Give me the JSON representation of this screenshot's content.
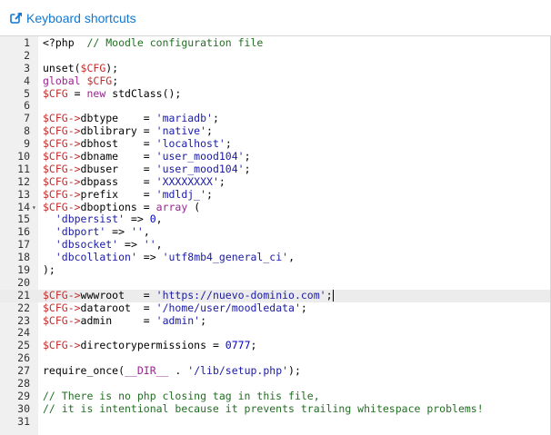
{
  "toolbar": {
    "shortcuts_label": "Keyboard shortcuts",
    "shortcuts_icon": "external-link-icon",
    "link_color": "#1177d1"
  },
  "editor": {
    "active_line": 21,
    "lines": [
      {
        "n": "1",
        "tokens": [
          {
            "t": "<?php",
            "c": "plain"
          },
          {
            "t": "  // Moodle configuration file",
            "c": "cm"
          }
        ]
      },
      {
        "n": "2",
        "tokens": []
      },
      {
        "n": "3",
        "tokens": [
          {
            "t": "unset(",
            "c": "plain"
          },
          {
            "t": "$CFG",
            "c": "var"
          },
          {
            "t": ");",
            "c": "plain"
          }
        ]
      },
      {
        "n": "4",
        "tokens": [
          {
            "t": "global",
            "c": "kw"
          },
          {
            "t": " ",
            "c": "plain"
          },
          {
            "t": "$CFG",
            "c": "var"
          },
          {
            "t": ";",
            "c": "plain"
          }
        ]
      },
      {
        "n": "5",
        "tokens": [
          {
            "t": "$CFG",
            "c": "var"
          },
          {
            "t": " = ",
            "c": "plain"
          },
          {
            "t": "new",
            "c": "kw"
          },
          {
            "t": " stdClass();",
            "c": "plain"
          }
        ]
      },
      {
        "n": "6",
        "tokens": []
      },
      {
        "n": "7",
        "tokens": [
          {
            "t": "$CFG->",
            "c": "var"
          },
          {
            "t": "dbtype    = ",
            "c": "plain"
          },
          {
            "t": "'mariadb'",
            "c": "str"
          },
          {
            "t": ";",
            "c": "plain"
          }
        ]
      },
      {
        "n": "8",
        "tokens": [
          {
            "t": "$CFG->",
            "c": "var"
          },
          {
            "t": "dblibrary = ",
            "c": "plain"
          },
          {
            "t": "'native'",
            "c": "str"
          },
          {
            "t": ";",
            "c": "plain"
          }
        ]
      },
      {
        "n": "9",
        "tokens": [
          {
            "t": "$CFG->",
            "c": "var"
          },
          {
            "t": "dbhost    = ",
            "c": "plain"
          },
          {
            "t": "'localhost'",
            "c": "str"
          },
          {
            "t": ";",
            "c": "plain"
          }
        ]
      },
      {
        "n": "10",
        "tokens": [
          {
            "t": "$CFG->",
            "c": "var"
          },
          {
            "t": "dbname    = ",
            "c": "plain"
          },
          {
            "t": "'user_mood104'",
            "c": "str"
          },
          {
            "t": ";",
            "c": "plain"
          }
        ]
      },
      {
        "n": "11",
        "tokens": [
          {
            "t": "$CFG->",
            "c": "var"
          },
          {
            "t": "dbuser    = ",
            "c": "plain"
          },
          {
            "t": "'user_mood104'",
            "c": "str"
          },
          {
            "t": ";",
            "c": "plain"
          }
        ]
      },
      {
        "n": "12",
        "tokens": [
          {
            "t": "$CFG->",
            "c": "var"
          },
          {
            "t": "dbpass    = ",
            "c": "plain"
          },
          {
            "t": "'XXXXXXXX'",
            "c": "str"
          },
          {
            "t": ";",
            "c": "plain"
          }
        ]
      },
      {
        "n": "13",
        "tokens": [
          {
            "t": "$CFG->",
            "c": "var"
          },
          {
            "t": "prefix    = ",
            "c": "plain"
          },
          {
            "t": "'mdldj_'",
            "c": "str"
          },
          {
            "t": ";",
            "c": "plain"
          }
        ]
      },
      {
        "n": "14",
        "fold": true,
        "tokens": [
          {
            "t": "$CFG->",
            "c": "var"
          },
          {
            "t": "dboptions = ",
            "c": "plain"
          },
          {
            "t": "array",
            "c": "kw"
          },
          {
            "t": " (",
            "c": "plain"
          }
        ]
      },
      {
        "n": "15",
        "tokens": [
          {
            "t": "  ",
            "c": "plain"
          },
          {
            "t": "'dbpersist'",
            "c": "str"
          },
          {
            "t": " => ",
            "c": "plain"
          },
          {
            "t": "0",
            "c": "num-lit"
          },
          {
            "t": ",",
            "c": "plain"
          }
        ]
      },
      {
        "n": "16",
        "tokens": [
          {
            "t": "  ",
            "c": "plain"
          },
          {
            "t": "'dbport'",
            "c": "str"
          },
          {
            "t": " => ",
            "c": "plain"
          },
          {
            "t": "''",
            "c": "str"
          },
          {
            "t": ",",
            "c": "plain"
          }
        ]
      },
      {
        "n": "17",
        "tokens": [
          {
            "t": "  ",
            "c": "plain"
          },
          {
            "t": "'dbsocket'",
            "c": "str"
          },
          {
            "t": " => ",
            "c": "plain"
          },
          {
            "t": "''",
            "c": "str"
          },
          {
            "t": ",",
            "c": "plain"
          }
        ]
      },
      {
        "n": "18",
        "tokens": [
          {
            "t": "  ",
            "c": "plain"
          },
          {
            "t": "'dbcollation'",
            "c": "str"
          },
          {
            "t": " => ",
            "c": "plain"
          },
          {
            "t": "'utf8mb4_general_ci'",
            "c": "str"
          },
          {
            "t": ",",
            "c": "plain"
          }
        ]
      },
      {
        "n": "19",
        "tokens": [
          {
            "t": ");",
            "c": "plain"
          }
        ]
      },
      {
        "n": "20",
        "tokens": []
      },
      {
        "n": "21",
        "cursor": true,
        "tokens": [
          {
            "t": "$CFG->",
            "c": "var"
          },
          {
            "t": "wwwroot   = ",
            "c": "plain"
          },
          {
            "t": "'https://nuevo-dominio.com'",
            "c": "str"
          },
          {
            "t": ";",
            "c": "plain"
          }
        ]
      },
      {
        "n": "22",
        "tokens": [
          {
            "t": "$CFG->",
            "c": "var"
          },
          {
            "t": "dataroot  = ",
            "c": "plain"
          },
          {
            "t": "'/home/user/moodledata'",
            "c": "str"
          },
          {
            "t": ";",
            "c": "plain"
          }
        ]
      },
      {
        "n": "23",
        "tokens": [
          {
            "t": "$CFG->",
            "c": "var"
          },
          {
            "t": "admin     = ",
            "c": "plain"
          },
          {
            "t": "'admin'",
            "c": "str"
          },
          {
            "t": ";",
            "c": "plain"
          }
        ]
      },
      {
        "n": "24",
        "tokens": []
      },
      {
        "n": "25",
        "tokens": [
          {
            "t": "$CFG->",
            "c": "var"
          },
          {
            "t": "directorypermissions = ",
            "c": "plain"
          },
          {
            "t": "0777",
            "c": "num-lit"
          },
          {
            "t": ";",
            "c": "plain"
          }
        ]
      },
      {
        "n": "26",
        "tokens": []
      },
      {
        "n": "27",
        "tokens": [
          {
            "t": "require_once(",
            "c": "plain"
          },
          {
            "t": "__DIR__",
            "c": "kw"
          },
          {
            "t": " . ",
            "c": "plain"
          },
          {
            "t": "'/lib/setup.php'",
            "c": "str"
          },
          {
            "t": ");",
            "c": "plain"
          }
        ]
      },
      {
        "n": "28",
        "tokens": []
      },
      {
        "n": "29",
        "tokens": [
          {
            "t": "// There is no php closing tag in this file,",
            "c": "cm"
          }
        ]
      },
      {
        "n": "30",
        "tokens": [
          {
            "t": "// it is intentional because it prevents trailing whitespace problems!",
            "c": "cm"
          }
        ]
      },
      {
        "n": "31",
        "tokens": []
      }
    ]
  }
}
